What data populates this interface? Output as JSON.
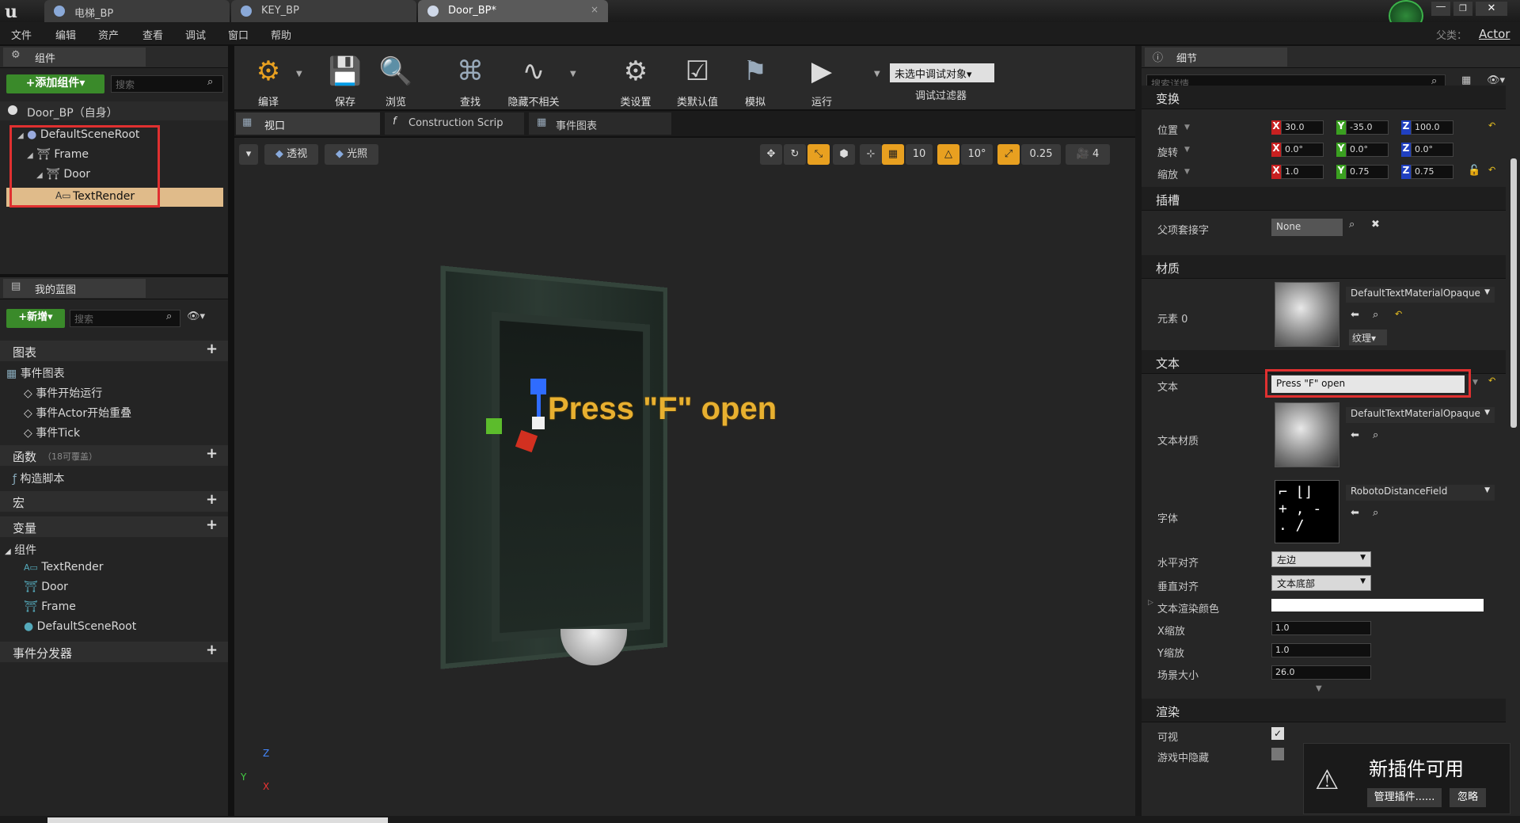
{
  "tabs": [
    {
      "label": "电梯_BP"
    },
    {
      "label": "KEY_BP"
    },
    {
      "label": "Door_BP*"
    }
  ],
  "menu": [
    "文件",
    "编辑",
    "资产",
    "查看",
    "调试",
    "窗口",
    "帮助"
  ],
  "parent_class": {
    "label": "父类：",
    "value": "Actor"
  },
  "components_panel": {
    "title": "组件",
    "add_button": "+添加组件▾",
    "search_placeholder": "搜索",
    "self_label": "Door_BP（自身）",
    "tree": [
      "DefaultSceneRoot",
      "Frame",
      "Door",
      "TextRender"
    ]
  },
  "my_blueprint": {
    "title": "我的蓝图",
    "new_button": "+新增▾",
    "search_placeholder": "搜索",
    "sections": {
      "graphs": "图表",
      "event_graph": "事件图表",
      "events": [
        "事件开始运行",
        "事件Actor开始重叠",
        "事件Tick"
      ],
      "functions": "函数",
      "functions_note": "（18可覆盖）",
      "construction": "构造脚本",
      "macros": "宏",
      "variables": "变量",
      "components": "组件",
      "component_vars": [
        "TextRender",
        "Door",
        "Frame",
        "DefaultSceneRoot"
      ],
      "dispatchers": "事件分发器"
    }
  },
  "toolbar": {
    "buttons": [
      "编译",
      "保存",
      "浏览",
      "查找",
      "隐藏不相关",
      "类设置",
      "类默认值",
      "模拟",
      "运行"
    ],
    "debug_select": "未选中调试对象▾",
    "debug_filter": "调试过滤器"
  },
  "editor_tabs": [
    "视口",
    "Construction Scrip",
    "事件图表"
  ],
  "viewport": {
    "perspective": "透视",
    "lit": "光照",
    "grid_snap": "10",
    "rot_snap": "10°",
    "scale_snap": "0.25",
    "cam_speed": "4",
    "text3d": "Press \"F\" open",
    "axis_y": "Y",
    "axis_z": "Z",
    "axis_x": "X"
  },
  "details": {
    "title": "细节",
    "search_placeholder": "搜索详情",
    "transform": {
      "section": "变换",
      "location": {
        "label": "位置",
        "x": "30.0",
        "y": "-35.0",
        "z": "100.0"
      },
      "rotation": {
        "label": "旋转",
        "x": "0.0°",
        "y": "0.0°",
        "z": "0.0°"
      },
      "scale": {
        "label": "缩放",
        "x": "1.0",
        "y": "0.75",
        "z": "0.75"
      }
    },
    "socket": {
      "section": "插槽",
      "label": "父项套接字",
      "value": "None"
    },
    "materials": {
      "section": "材质",
      "label": "元素 0",
      "value": "DefaultTextMaterialOpaque",
      "texture_btn": "纹理▾"
    },
    "text": {
      "section": "文本",
      "text_label": "文本",
      "text_value": "Press \"F\" open",
      "material_label": "文本材质",
      "material_value": "DefaultTextMaterialOpaque",
      "font_label": "字体",
      "font_value": "RobotoDistanceField",
      "halign_label": "水平对齐",
      "halign_value": "左边",
      "valign_label": "垂直对齐",
      "valign_value": "文本底部",
      "color_label": "文本渲染颜色",
      "xscale_label": "X缩放",
      "xscale_value": "1.0",
      "yscale_label": "Y缩放",
      "yscale_value": "1.0",
      "worldsize_label": "场景大小",
      "worldsize_value": "26.0"
    },
    "render": {
      "section": "渲染",
      "visible_label": "可视",
      "hidden_label": "游戏中隐藏"
    }
  },
  "notification": {
    "title": "新插件可用",
    "manage": "管理插件......",
    "dismiss": "忽略"
  },
  "colors": {
    "accent": "#e8a020",
    "highlight": "#e03030",
    "selected_row": "#e0bb8a"
  }
}
